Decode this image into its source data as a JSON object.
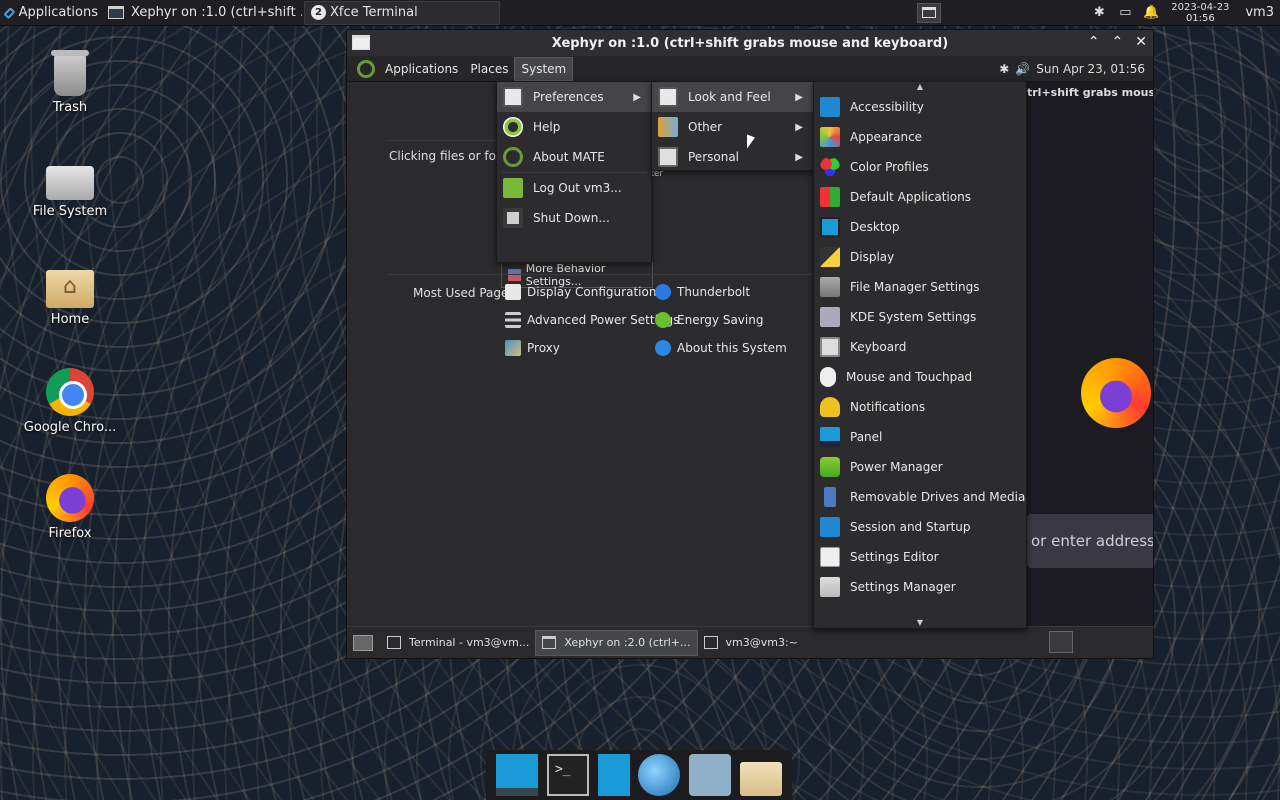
{
  "top_panel": {
    "applications_label": "Applications",
    "tasks": [
      {
        "label": "Xephyr on :1.0 (ctrl+shift ..."
      },
      {
        "badge": "2",
        "label": "Xfce Terminal"
      }
    ],
    "clock_date": "2023-04-23",
    "clock_time": "01:56",
    "user": "vm3"
  },
  "desktop_icons": [
    {
      "label": "Trash"
    },
    {
      "label": "File System"
    },
    {
      "label": "Home"
    },
    {
      "label": "Google Chro..."
    },
    {
      "label": "Firefox"
    }
  ],
  "xephyr": {
    "title": "Xephyr on :1.0 (ctrl+shift grabs mouse and keyboard)",
    "panel_menus": [
      "Applications",
      "Places",
      "System"
    ],
    "panel_clock": "Sun Apr 23, 01:56",
    "background_app": {
      "clicking_label": "Clicking files or folders:",
      "fragment_ker": "ker",
      "more_behavior_label": "More Behavior Settings...",
      "most_used_label": "Most Used Pages:",
      "links": [
        {
          "label": "Display Configuration",
          "color": "#e8e8e8"
        },
        {
          "label": "Thunderbolt",
          "color": "#2a7ae2"
        },
        {
          "label": "Advanced Power Settings",
          "color": "#cccccc"
        },
        {
          "label": "Energy Saving",
          "color": "#6ac02a"
        },
        {
          "label": "Proxy",
          "color": "#4a90c0"
        },
        {
          "label": "About this System",
          "color": "#2a8ae2"
        }
      ]
    },
    "firefox_fragment": {
      "banner": "trl+shift grabs mouse an",
      "address_placeholder": "or enter address"
    },
    "taskbar": [
      {
        "label": "Terminal - vm3@vm..."
      },
      {
        "label": "Xephyr on :2.0 (ctrl+..."
      },
      {
        "label": "vm3@vm3:~"
      }
    ]
  },
  "system_menu": {
    "items": [
      {
        "label": "Preferences",
        "has_submenu": true
      },
      {
        "label": "Help"
      },
      {
        "label": "About MATE"
      },
      {
        "label": "Log Out vm3..."
      },
      {
        "label": "Shut Down..."
      }
    ]
  },
  "preferences_menu": {
    "items": [
      {
        "label": "Look and Feel"
      },
      {
        "label": "Other"
      },
      {
        "label": "Personal"
      }
    ]
  },
  "other_menu": {
    "items": [
      {
        "label": "Accessibility"
      },
      {
        "label": "Appearance"
      },
      {
        "label": "Color Profiles"
      },
      {
        "label": "Default Applications"
      },
      {
        "label": "Desktop"
      },
      {
        "label": "Display"
      },
      {
        "label": "File Manager Settings"
      },
      {
        "label": "KDE System Settings"
      },
      {
        "label": "Keyboard"
      },
      {
        "label": "Mouse and Touchpad"
      },
      {
        "label": "Notifications"
      },
      {
        "label": "Panel"
      },
      {
        "label": "Power Manager"
      },
      {
        "label": "Removable Drives and Media"
      },
      {
        "label": "Session and Startup"
      },
      {
        "label": "Settings Editor"
      },
      {
        "label": "Settings Manager"
      }
    ]
  },
  "dock": {
    "items": [
      "desktop-icon",
      "terminal-icon",
      "files-icon",
      "web-browser-icon",
      "search-icon",
      "folder-icon"
    ]
  }
}
